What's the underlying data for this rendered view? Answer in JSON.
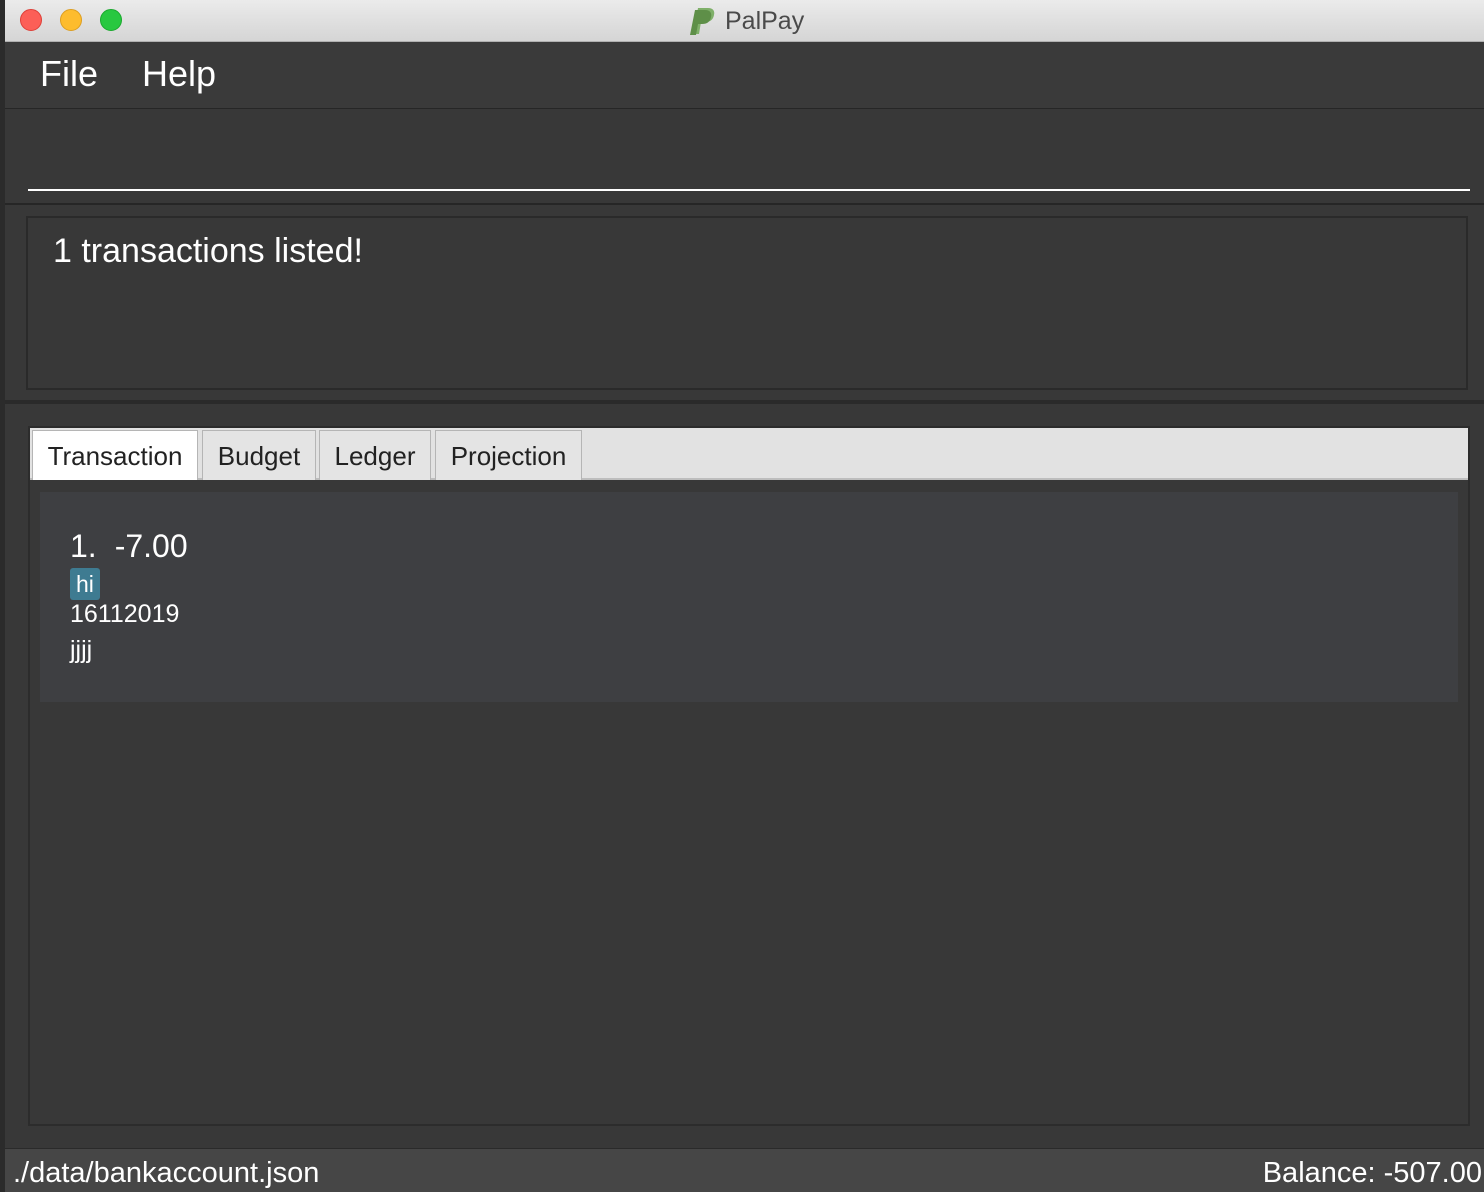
{
  "window": {
    "title": "PalPay",
    "logo_icon": "paypal-p-logo"
  },
  "menu": {
    "file_label": "File",
    "help_label": "Help"
  },
  "command": {
    "value": ""
  },
  "result": {
    "message": "1 transactions listed!"
  },
  "tabs": [
    {
      "label": "Transaction",
      "active": true
    },
    {
      "label": "Budget",
      "active": false
    },
    {
      "label": "Ledger",
      "active": false
    },
    {
      "label": "Projection",
      "active": false
    }
  ],
  "transactions": [
    {
      "index": "1.",
      "amount": "-7.00",
      "tag": "hi",
      "date": "16112019",
      "description": "jjjj"
    }
  ],
  "status": {
    "file_path": "./data/bankaccount.json",
    "balance": "Balance: -507.00"
  },
  "colors": {
    "background": "#383838",
    "tag": "#3e7b91",
    "close": "#fc5f57",
    "minimize": "#fdbc2e",
    "maximize": "#28c840",
    "logo": "#6aa84f"
  }
}
